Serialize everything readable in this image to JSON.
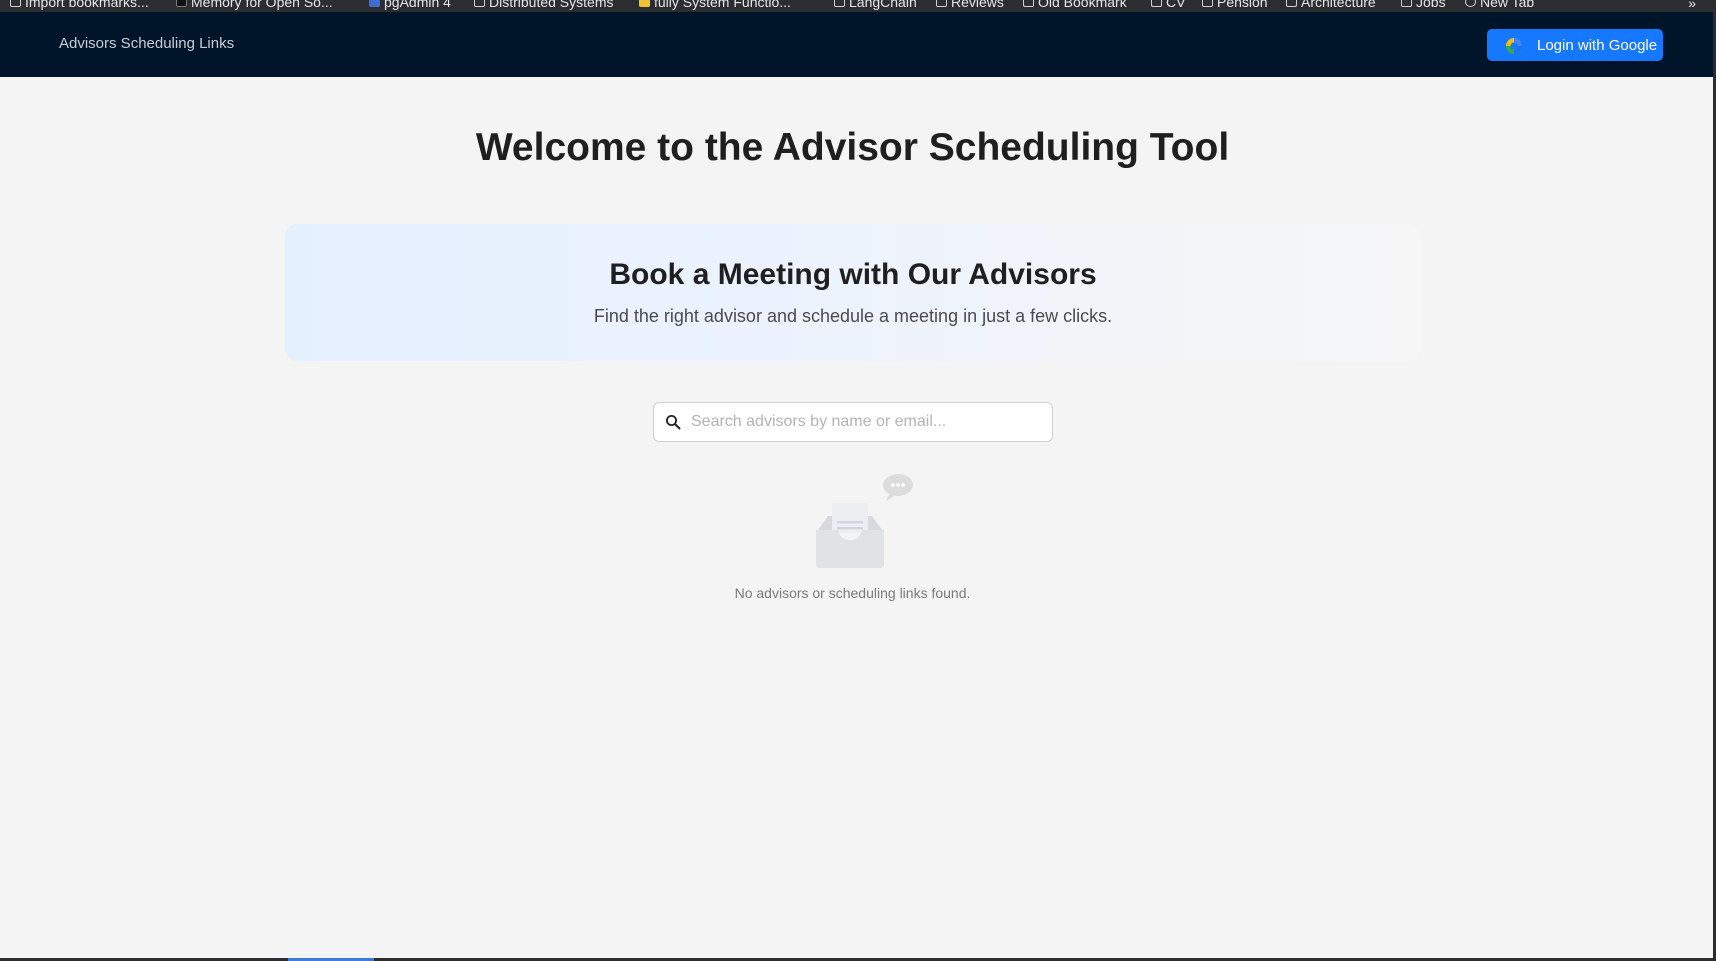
{
  "bookmarks": [
    {
      "label": "Import bookmarks...",
      "icon": "page-icon"
    },
    {
      "label": "Memory for Open So...",
      "icon": "site-icon"
    },
    {
      "label": "pgAdmin 4",
      "icon": "pgadmin-icon"
    },
    {
      "label": "Distributed Systems",
      "icon": "folder-icon"
    },
    {
      "label": "fully System Functio...",
      "icon": "site-icon"
    },
    {
      "label": "LangChain",
      "icon": "folder-icon"
    },
    {
      "label": "Reviews",
      "icon": "folder-icon"
    },
    {
      "label": "Old Bookmark",
      "icon": "folder-icon"
    },
    {
      "label": "CV",
      "icon": "folder-icon"
    },
    {
      "label": "Pension",
      "icon": "folder-icon"
    },
    {
      "label": "Architecture",
      "icon": "folder-icon"
    },
    {
      "label": "Jobs",
      "icon": "folder-icon"
    },
    {
      "label": "New Tab",
      "icon": "globe-icon"
    }
  ],
  "bookmarks_overflow": "»",
  "navbar": {
    "brand": "Advisors Scheduling Links",
    "login_label": "Login with Google",
    "login_color": "#1677ff",
    "background": "#00152a"
  },
  "main": {
    "title": "Welcome to the Advisor Scheduling Tool"
  },
  "hero": {
    "title": "Book a Meeting with Our Advisors",
    "subtitle": "Find the right advisor and schedule a meeting in just a few clicks."
  },
  "search": {
    "placeholder": "Search advisors by name or email...",
    "value": ""
  },
  "empty_state": {
    "icon": "empty-inbox-icon",
    "message": "No advisors or scheduling links found."
  }
}
